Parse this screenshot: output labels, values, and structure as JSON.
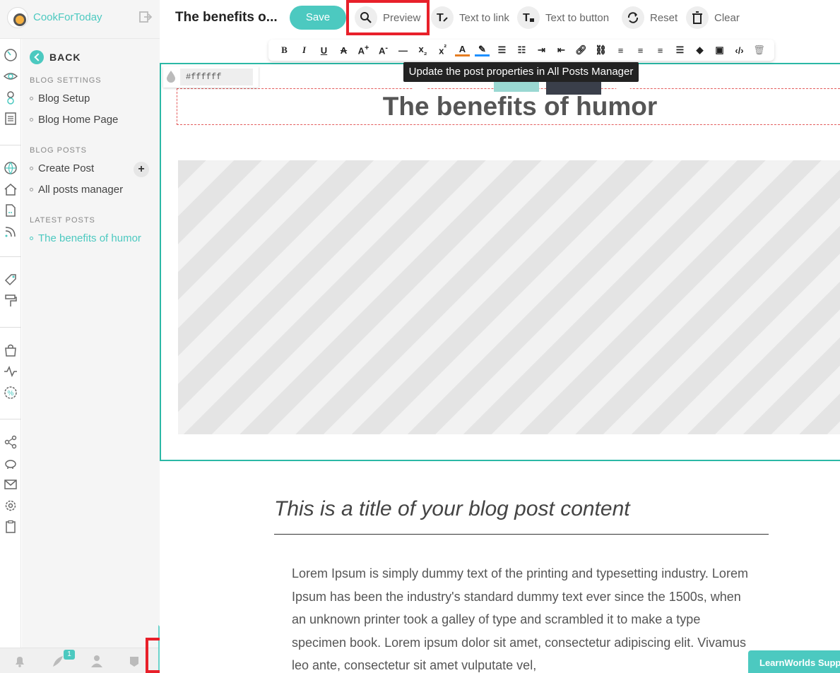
{
  "brand": {
    "name": "CookForToday"
  },
  "sidebar": {
    "back_label": "BACK",
    "sections": [
      {
        "heading": "BLOG SETTINGS",
        "items": [
          "Blog Setup",
          "Blog Home Page"
        ]
      },
      {
        "heading": "BLOG POSTS",
        "items": [
          "Create Post",
          "All posts manager"
        ]
      },
      {
        "heading": "LATEST POSTS",
        "items": [
          "The benefits of humor"
        ]
      }
    ],
    "active_item": "The benefits of humor"
  },
  "bottom_bar": {
    "notifications_badge": "1"
  },
  "topbar": {
    "page_title": "The benefits o...",
    "save_label": "Save",
    "preview_label": "Preview",
    "text_to_link_label": "Text to link",
    "text_to_button_label": "Text to button",
    "reset_label": "Reset",
    "clear_label": "Clear"
  },
  "format_toolbar": {
    "buttons": [
      "bold",
      "italic",
      "underline",
      "strikethrough",
      "font-size-up",
      "font-size-down",
      "horizontal-rule",
      "subscript",
      "superscript",
      "text-color",
      "highlight",
      "bullet-list",
      "numbered-list",
      "indent",
      "outdent",
      "link",
      "unlink",
      "align-left",
      "align-center",
      "align-right",
      "justify",
      "clear-format",
      "image",
      "code",
      "delete"
    ]
  },
  "tooltip": {
    "text": "Update the post properties in All Posts Manager"
  },
  "color_picker": {
    "value": "#ffffff"
  },
  "post": {
    "title": "The benefits of humor",
    "subtitle": "This is a title of your blog post content",
    "body": "Lorem Ipsum is simply dummy text of the printing and typesetting industry. Lorem Ipsum has been the industry's standard dummy text ever since the 1500s, when an unknown printer took a galley of type and scrambled it to make a type specimen book. Lorem ipsum dolor sit amet, consectetur adipiscing elit. Vivamus leo ante, consectetur sit amet vulputate vel,"
  },
  "support": {
    "label": "LearnWorlds Support"
  },
  "colors": {
    "accent": "#4cc9c0",
    "highlight_frame": "#e8202a",
    "section_border": "#2bb8a6"
  }
}
